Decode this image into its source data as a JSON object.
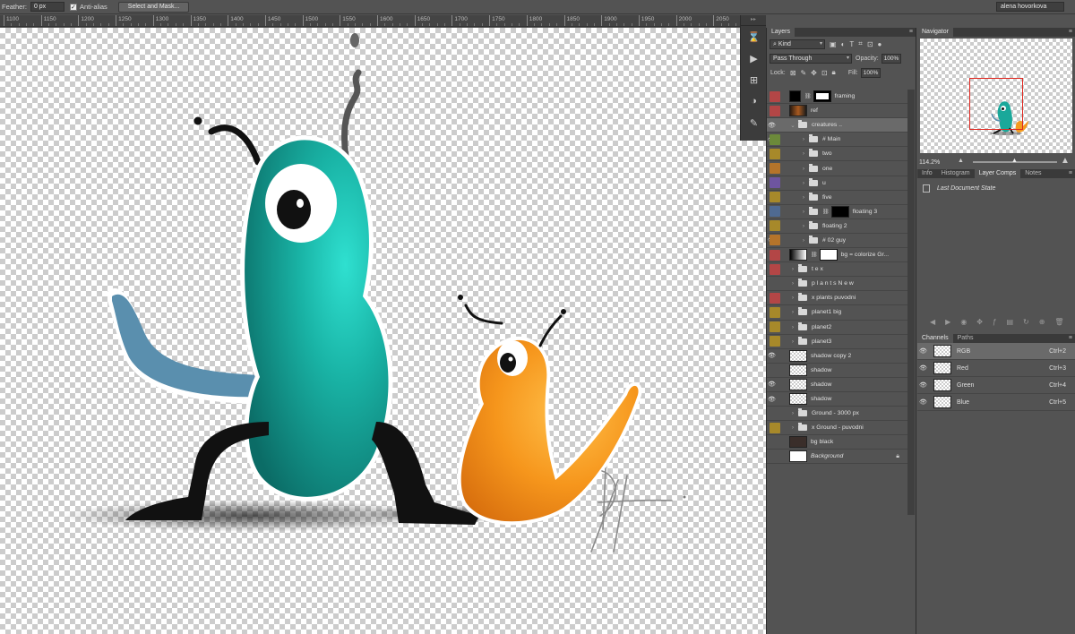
{
  "options_bar": {
    "feather_label": "Feather:",
    "feather_value": "0 px",
    "anti_alias_label": "Anti-alias",
    "select_mask_button": "Select and Mask...",
    "user_name": "alena hovorkova"
  },
  "ruler": {
    "ticks": [
      "1100",
      "1150",
      "1200",
      "1250",
      "1300",
      "1350",
      "1400",
      "1450",
      "1500",
      "1550",
      "1600",
      "1650",
      "1700",
      "1750",
      "1800",
      "1850",
      "1900",
      "1950",
      "2000",
      "2050"
    ]
  },
  "layers_panel": {
    "tab": "Layers",
    "filter_kind": "Kind",
    "blend_mode": "Pass Through",
    "opacity_label": "Opacity:",
    "opacity_value": "100%",
    "lock_label": "Lock:",
    "fill_label": "Fill:",
    "fill_value": "100%",
    "layers": [
      {
        "name": "framing",
        "color": "#b34646",
        "visible": false,
        "type": "mask"
      },
      {
        "name": "ref",
        "color": "#b34646",
        "visible": false,
        "type": "image"
      },
      {
        "name": "creatures ..",
        "color": "",
        "visible": true,
        "type": "group-open"
      },
      {
        "name": "# Main",
        "color": "#6c8a3a",
        "visible": true,
        "type": "group"
      },
      {
        "name": "two",
        "color": "#a7892a",
        "visible": false,
        "type": "group"
      },
      {
        "name": "one",
        "color": "#b5742a",
        "visible": false,
        "type": "group"
      },
      {
        "name": "u",
        "color": "#6e55a0",
        "visible": false,
        "type": "group"
      },
      {
        "name": "five",
        "color": "#a7892a",
        "visible": false,
        "type": "group"
      },
      {
        "name": "floating 3",
        "color": "#4f6a92",
        "visible": false,
        "type": "group-mask"
      },
      {
        "name": "floating 2",
        "color": "#a7892a",
        "visible": false,
        "type": "group"
      },
      {
        "name": "# 02 guy",
        "color": "#b5742a",
        "visible": true,
        "type": "group"
      },
      {
        "name": "bg = colorize Gr...",
        "color": "#b34646",
        "visible": false,
        "type": "adjust"
      },
      {
        "name": "t e x",
        "color": "#b34646",
        "visible": false,
        "type": "group"
      },
      {
        "name": "p l a n t s  N e w",
        "color": "",
        "visible": false,
        "type": "group"
      },
      {
        "name": "x plants puvodni",
        "color": "#b34646",
        "visible": false,
        "type": "group"
      },
      {
        "name": "planet1 big",
        "color": "#a7892a",
        "visible": false,
        "type": "group"
      },
      {
        "name": "planet2",
        "color": "#a7892a",
        "visible": false,
        "type": "group"
      },
      {
        "name": "planet3",
        "color": "#a7892a",
        "visible": false,
        "type": "group"
      },
      {
        "name": "shadow copy 2",
        "color": "",
        "visible": true,
        "type": "pixel"
      },
      {
        "name": "shadow",
        "color": "",
        "visible": false,
        "type": "pixel"
      },
      {
        "name": "shadow",
        "color": "",
        "visible": true,
        "type": "pixel"
      },
      {
        "name": "shadow",
        "color": "",
        "visible": true,
        "type": "pixel"
      },
      {
        "name": "Ground - 3000 px",
        "color": "",
        "visible": false,
        "type": "group"
      },
      {
        "name": "x Ground - puvodni",
        "color": "#a7892a",
        "visible": false,
        "type": "group"
      },
      {
        "name": "bg black",
        "color": "",
        "visible": false,
        "type": "dark"
      },
      {
        "name": "Background",
        "color": "",
        "visible": false,
        "type": "background"
      }
    ]
  },
  "navigator": {
    "tab": "Navigator",
    "zoom": "114.2%"
  },
  "info_tabs": [
    "Info",
    "Histogram",
    "Layer Comps",
    "Notes"
  ],
  "layer_comps": {
    "items": [
      "Last Document State"
    ]
  },
  "channels_panel": {
    "tabs": [
      "Channels",
      "Paths"
    ],
    "channels": [
      {
        "name": "RGB",
        "shortcut": "Ctrl+2"
      },
      {
        "name": "Red",
        "shortcut": "Ctrl+3"
      },
      {
        "name": "Green",
        "shortcut": "Ctrl+4"
      },
      {
        "name": "Blue",
        "shortcut": "Ctrl+5"
      }
    ]
  },
  "colors": {
    "teal_creature": "#1aa89a",
    "orange_creature": "#f49a1f",
    "panel_bg": "#535353",
    "selected_row": "#6a6a6a"
  }
}
